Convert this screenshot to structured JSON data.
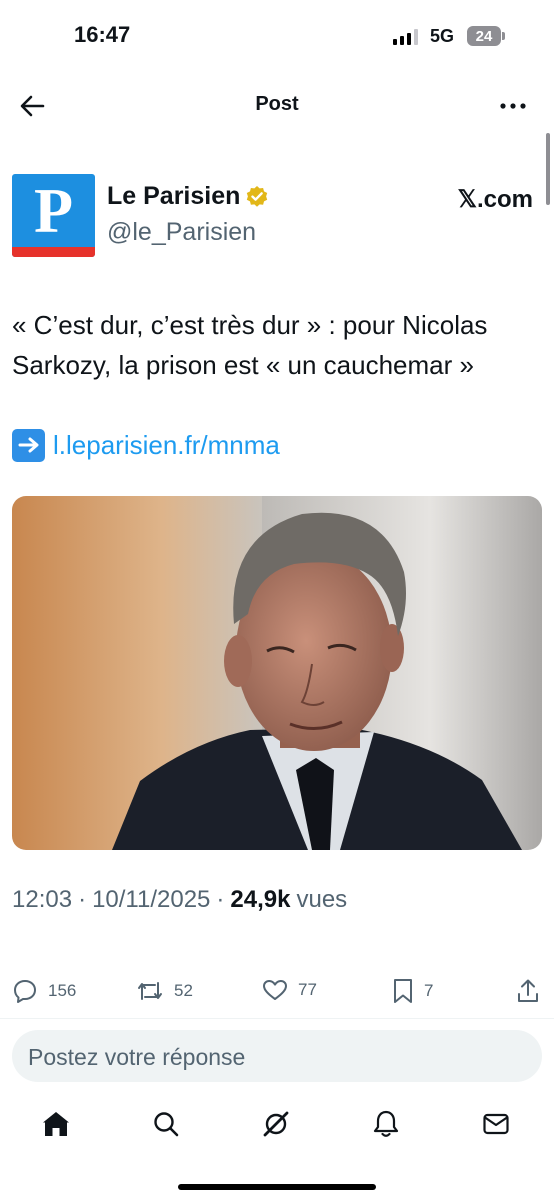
{
  "status_bar": {
    "time": "16:47",
    "network": "5G",
    "battery": "24"
  },
  "header": {
    "title": "Post"
  },
  "post": {
    "author_name": "Le Parisien",
    "author_handle": "@le_Parisien",
    "avatar_letter": "P",
    "source": "𝕏.com",
    "text": "« C’est dur, c’est très dur » : pour Nicolas Sarkozy, la prison est « un cauchemar »",
    "link": "l.leparisien.fr/mnma",
    "time": "12:03",
    "date": "10/11/2025",
    "views_count": "24,9k",
    "views_label": "vues"
  },
  "actions": {
    "replies": "156",
    "reposts": "52",
    "likes": "77",
    "bookmarks": "7"
  },
  "reply": {
    "placeholder": "Postez votre réponse"
  },
  "colors": {
    "accent": "#1d9bf0",
    "verified": "#e2b719",
    "avatar_blue": "#1d8fe0",
    "avatar_red": "#e6322b"
  },
  "icons": {
    "back": "arrow-left-icon",
    "more": "more-icon",
    "verified": "verified-badge-icon",
    "link_arrow": "arrow-right-emoji-icon",
    "reply": "reply-icon",
    "repost": "repost-icon",
    "like": "heart-icon",
    "bookmark": "bookmark-icon",
    "share": "share-icon",
    "home": "home-icon",
    "search": "search-icon",
    "grok": "grok-icon",
    "notifications": "bell-icon",
    "messages": "mail-icon"
  }
}
